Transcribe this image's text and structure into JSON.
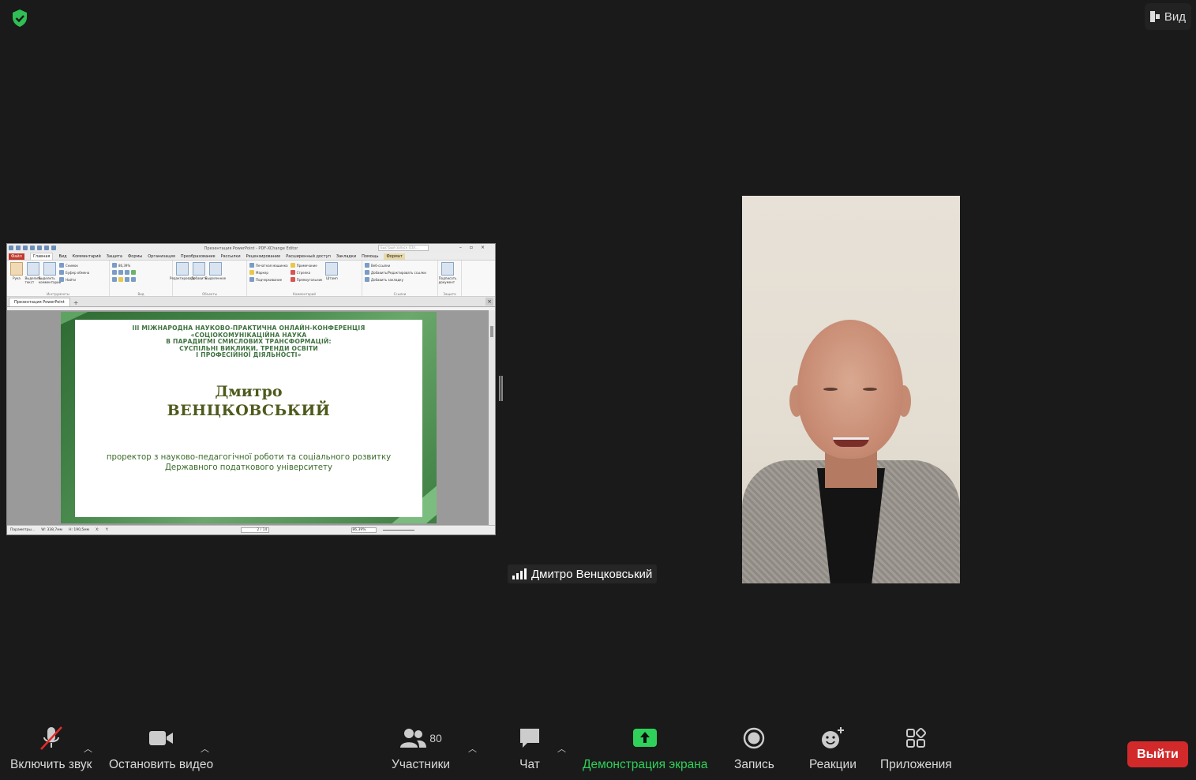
{
  "top": {
    "view_label": "Вид"
  },
  "shared_screen": {
    "window_title": "Презентация PowerPoint - PDF-XChange Editor",
    "search_placeholder": "Быстрый запуск (Ctrl...",
    "menu": [
      "Файл",
      "Главная",
      "Вид",
      "Комментарий",
      "Защита",
      "Формы",
      "Организация",
      "Преобразование",
      "Рассылки",
      "Рецензирование",
      "Расширенный доступ",
      "Закладки",
      "Помощь",
      "Формат"
    ],
    "ribbon": {
      "hand": "Рука",
      "select_text": "Выделить текст",
      "select_comments": "Выделить комментарии",
      "snapshot": "Снимок",
      "clipboard": "Буфер обмена",
      "find": "Найти",
      "group_tools": "Инструменты",
      "zoom": "86,39%",
      "group_view": "Вид",
      "edit": "Редактировать",
      "add": "Добавить",
      "selected": "Выделенное",
      "group_objects": "Объекты",
      "typewriter": "Печатная машинка",
      "note": "Примечание",
      "marker": "Маркер",
      "arrow": "Стрелка",
      "underline": "Подчеркивание",
      "rectangle": "Прямоугольник",
      "stamp": "Штамп",
      "group_comments": "Комментарий",
      "web_links": "Веб-ссылки",
      "add_edit_links": "Добавить/Редактировать ссылки",
      "add_bookmark": "Добавить закладку",
      "group_links": "Ссылки",
      "sign": "Подписать документ",
      "group_protect": "Защита"
    },
    "tab_name": "Презентация PowerPoint",
    "slide": {
      "conf_line1": "ІІІ МІЖНАРОДНА НАУКОВО-ПРАКТИЧНА ОНЛАЙН-КОНФЕРЕНЦІЯ",
      "conf_line2": "«СОЦІОКОМУНІКАЦІЙНА НАУКА",
      "conf_line3": "В ПАРАДИГМІ СМИСЛОВИХ ТРАНСФОРМАЦІЙ:",
      "conf_line4": "СУСПІЛЬНІ ВИКЛИКИ, ТРЕНДИ ОСВІТИ",
      "conf_line5": "І ПРОФЕСІЙНОЇ ДІЯЛЬНОСТІ»",
      "first_name": "Дмитро",
      "last_name": "ВЕНЦКОВСЬКИЙ",
      "role_line1": "проректор з науково-педагогічної роботи та соціального розвитку",
      "role_line2": "Державного податкового університету"
    },
    "status": {
      "params": "Параметры...",
      "width": "W: 338,7мм",
      "height": "H: 190,5мм",
      "x": "X:",
      "y": "Y:",
      "page": "2 / 14",
      "zoom": "86,39%"
    }
  },
  "speaker": {
    "name": "Дмитро Венцковський"
  },
  "toolbar": {
    "unmute": "Включить звук",
    "stop_video": "Остановить видео",
    "participants": "Участники",
    "participants_count": "80",
    "chat": "Чат",
    "share_screen": "Демонстрация экрана",
    "record": "Запись",
    "reactions": "Реакции",
    "apps": "Приложения",
    "leave": "Выйти"
  },
  "colors": {
    "share_green": "#2fd15a",
    "leave_red": "#d2292b",
    "shield_green": "#2fbf54"
  }
}
